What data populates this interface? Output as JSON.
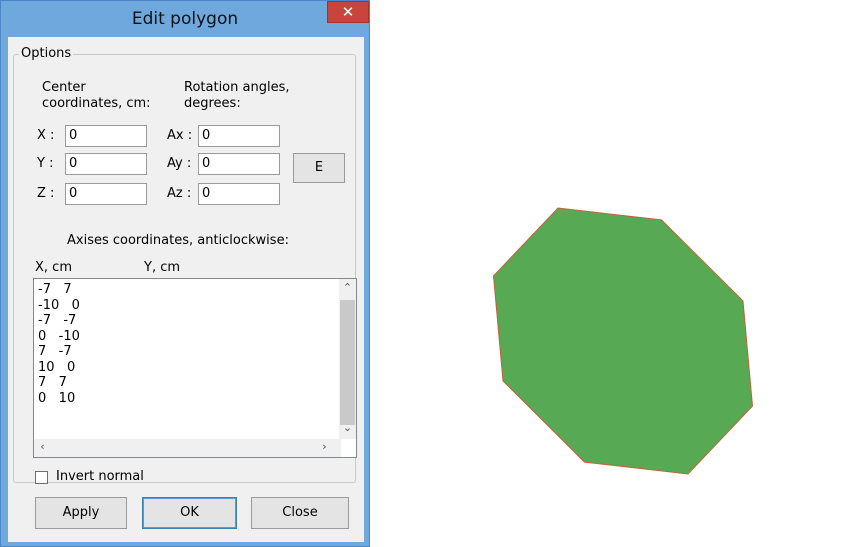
{
  "dialog": {
    "title": "Edit polygon",
    "close_glyph": "✕",
    "options_label": "Options",
    "center_label_line1": "Center",
    "center_label_line2": "coordinates, cm:",
    "rotation_label_line1": "Rotation angles,",
    "rotation_label_line2": "degrees:",
    "x_label": "X :",
    "y_label": "Y :",
    "z_label": "Z :",
    "ax_label": "Ax :",
    "ay_label": "Ay :",
    "az_label": "Az :",
    "x_value": "0",
    "y_value": "0",
    "z_value": "0",
    "ax_value": "0",
    "ay_value": "0",
    "az_value": "0",
    "e_button": "E",
    "axises_label": "Axises coordinates, anticlockwise:",
    "col_x": "X, cm",
    "col_y": "Y, cm",
    "coordinates_text": "-7   7\n-10   0\n-7   -7\n0   -10\n7   -7\n10   0\n7   7\n0   10",
    "invert_normal_label": "Invert normal",
    "invert_normal_checked": false,
    "apply_button": "Apply",
    "ok_button": "OK",
    "close_button": "Close",
    "scroll_up_glyph": "⌃",
    "scroll_down_glyph": "⌄",
    "scroll_left_glyph": "‹",
    "scroll_right_glyph": "›"
  },
  "preview": {
    "fill_color": "#57aa53",
    "stroke_color": "#c8603a",
    "vertices_cm": [
      [
        -7,
        7
      ],
      [
        -10,
        0
      ],
      [
        -7,
        -7
      ],
      [
        0,
        -10
      ],
      [
        7,
        -7
      ],
      [
        10,
        0
      ],
      [
        7,
        7
      ],
      [
        0,
        10
      ]
    ]
  }
}
